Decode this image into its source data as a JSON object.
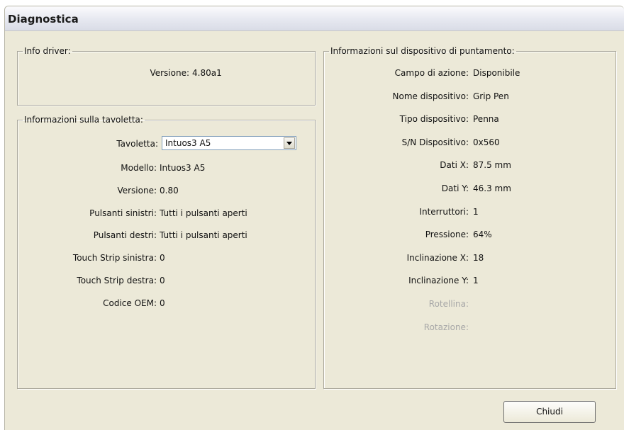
{
  "window": {
    "title": "Diagnostica"
  },
  "driver": {
    "legend": "Info driver:",
    "version_label": "Versione:",
    "version_value": "4.80a1"
  },
  "tablet": {
    "legend": "Informazioni sulla tavoletta:",
    "tablet_label": "Tavoletta:",
    "tablet_selected": "Intuos3 A5",
    "rows": [
      {
        "label": "Modello:",
        "value": "Intuos3 A5"
      },
      {
        "label": "Versione:",
        "value": "0.80"
      },
      {
        "label": "Pulsanti sinistri:",
        "value": "Tutti i pulsanti aperti"
      },
      {
        "label": "Pulsanti destri:",
        "value": "Tutti i pulsanti aperti"
      },
      {
        "label": "Touch Strip sinistra:",
        "value": "0"
      },
      {
        "label": "Touch Strip destra:",
        "value": "0"
      },
      {
        "label": "Codice OEM:",
        "value": "0"
      }
    ]
  },
  "pointer": {
    "legend": "Informazioni sul dispositivo di puntamento:",
    "rows": [
      {
        "label": "Campo di azione:",
        "value": "Disponibile"
      },
      {
        "label": "Nome dispositivo:",
        "value": "Grip Pen"
      },
      {
        "label": "Tipo dispositivo:",
        "value": "Penna"
      },
      {
        "label": "S/N Dispositivo:",
        "value": "0x560"
      },
      {
        "label": "Dati X:",
        "value": "87.5 mm"
      },
      {
        "label": "Dati Y:",
        "value": "46.3 mm"
      },
      {
        "label": "Interruttori:",
        "value": "1"
      },
      {
        "label": "Pressione:",
        "value": "64%"
      },
      {
        "label": "Inclinazione X:",
        "value": "18"
      },
      {
        "label": "Inclinazione Y:",
        "value": "1"
      },
      {
        "label": "Rotellina:",
        "value": ""
      },
      {
        "label": "Rotazione:",
        "value": ""
      }
    ]
  },
  "buttons": {
    "close": "Chiudi"
  }
}
